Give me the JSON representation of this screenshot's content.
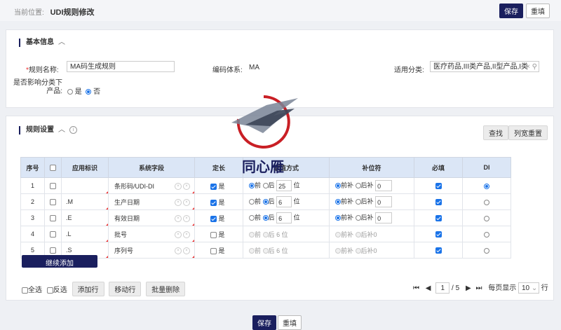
{
  "breadcrumb": {
    "prefix": "当前位置:",
    "title": "UDI规则修改"
  },
  "header": {
    "save_label": "保存",
    "reset_label": "重填"
  },
  "basic": {
    "title": "基本信息",
    "collapse_icon": "chevron-up-icon",
    "rule_name_label": "规则名称:",
    "rule_name_value": "MA码生成规则",
    "encoding_label": "编码体系:",
    "encoding_value": "MA",
    "category_label": "适用分类:",
    "category_value": "医疗药品,III类产品,II型产品,I类",
    "affect_label": "是否影响分类下产品:",
    "affect_options": [
      "是",
      "否"
    ],
    "affect_selected": "否"
  },
  "rules": {
    "title": "规则设置",
    "find_label": "查找",
    "reset_width_label": "列宽重置",
    "columns": [
      "序号",
      "",
      "应用标识",
      "系统字段",
      "定长",
      "取值方式",
      "补位符",
      "必填",
      "DI"
    ],
    "rows": [
      {
        "no": "1",
        "ai": "",
        "field": "条形码/UDI-DI",
        "fixed": true,
        "fixed_label": "是",
        "mode": "前",
        "mode_alt": "后",
        "value_front": "前",
        "value_back": "后",
        "len": "25",
        "unit": "位",
        "pad_front": "前补",
        "pad_back": "后补",
        "pad_sel": "前补",
        "pad_val": "0",
        "required": true,
        "di": true,
        "disabled": false
      },
      {
        "no": "2",
        "ai": ".M",
        "field": "生产日期",
        "fixed": true,
        "fixed_label": "是",
        "value_front": "前",
        "value_back": "后",
        "mode": "后",
        "len": "6",
        "unit": "位",
        "pad_front": "前补",
        "pad_back": "后补",
        "pad_sel": "前补",
        "pad_val": "0",
        "required": true,
        "di": false,
        "disabled": false
      },
      {
        "no": "3",
        "ai": ".E",
        "field": "有效日期",
        "fixed": true,
        "fixed_label": "是",
        "value_front": "前",
        "value_back": "后",
        "mode": "后",
        "len": "6",
        "unit": "位",
        "pad_front": "前补",
        "pad_back": "后补",
        "pad_sel": "前补",
        "pad_val": "0",
        "required": true,
        "di": false,
        "disabled": false
      },
      {
        "no": "4",
        "ai": ".L",
        "field": "批号",
        "fixed": false,
        "fixed_label": "是",
        "value_front": "前",
        "value_back": "后",
        "mode": "",
        "len": "6",
        "unit": "位",
        "pad_front": "前补",
        "pad_back": "后补",
        "pad_sel": "",
        "pad_val": "0",
        "required": true,
        "di": false,
        "disabled": true
      },
      {
        "no": "5",
        "ai": ".S",
        "field": "序列号",
        "fixed": false,
        "fixed_label": "是",
        "value_front": "前",
        "value_back": "后",
        "mode": "",
        "len": "6",
        "unit": "位",
        "pad_front": "前补",
        "pad_back": "后补",
        "pad_sel": "",
        "pad_val": "0",
        "required": true,
        "di": false,
        "disabled": true
      }
    ],
    "continue_add_label": "继续添加",
    "select_all_label": "全选",
    "invert_label": "反选",
    "add_row_label": "添加行",
    "move_row_label": "移动行",
    "batch_delete_label": "批量删除",
    "pager": {
      "current": "1",
      "total": "/ 5",
      "per_page_label": "每页显示",
      "per_page_value": "10",
      "row_unit": "行"
    }
  },
  "watermark_text": "同心雁",
  "footer": {
    "save_label": "保存",
    "reset_label": "重填"
  },
  "colors": {
    "primary": "#1a1f5e",
    "accent": "#1a73e8",
    "required": "#e33333"
  }
}
